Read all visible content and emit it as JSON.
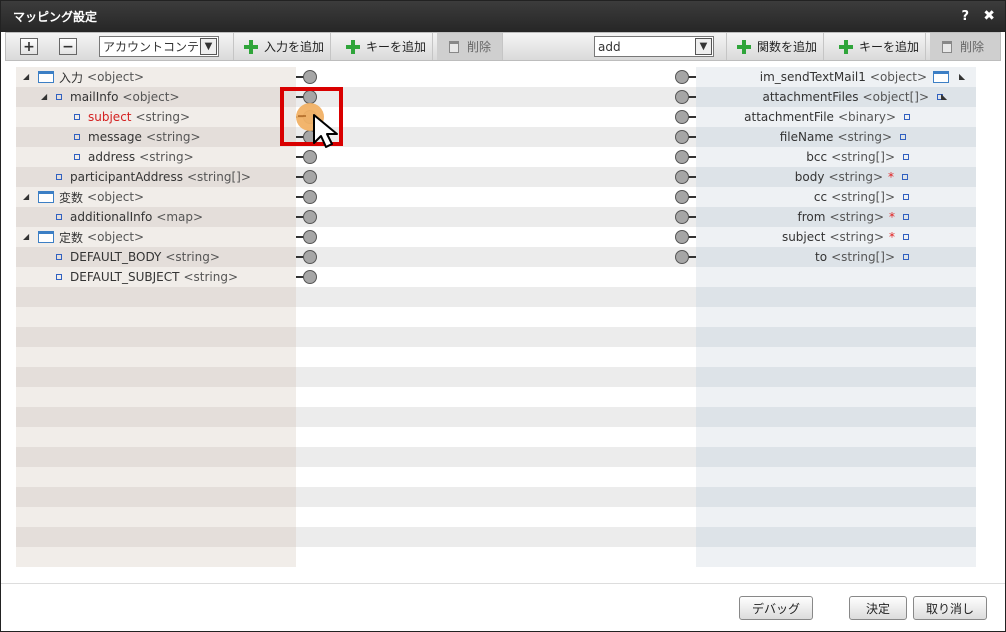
{
  "dialog": {
    "title": "マッピング設定",
    "help_label": "?",
    "close_label": "✖"
  },
  "toolbar": {
    "expand_label": "+",
    "collapse_label": "−",
    "input_select_value": "アカウントコンテ",
    "add_input_label": "入力を追加",
    "add_key_left_label": "キーを追加",
    "delete_left_label": "削除",
    "function_select_value": "add",
    "add_function_label": "関数を追加",
    "add_key_right_label": "キーを追加",
    "delete_right_label": "削除"
  },
  "left_tree": [
    {
      "name": "入力",
      "type": "<object>",
      "icon": "folder-icon",
      "expander": "◢"
    },
    {
      "name": "mailInfo",
      "type": "<object>",
      "icon": "leaf-icon",
      "expander": "◢"
    },
    {
      "name": "subject",
      "type": "<string>",
      "icon": "leaf-icon",
      "highlight": true
    },
    {
      "name": "message",
      "type": "<string>",
      "icon": "leaf-icon"
    },
    {
      "name": "address",
      "type": "<string>",
      "icon": "leaf-icon"
    },
    {
      "name": "participantAddress",
      "type": "<string[]>",
      "icon": "leaf-icon"
    },
    {
      "name": "変数",
      "type": "<object>",
      "icon": "folder-icon",
      "expander": "◢"
    },
    {
      "name": "additionalInfo",
      "type": "<map>",
      "icon": "leaf-icon"
    },
    {
      "name": "定数",
      "type": "<object>",
      "icon": "folder-icon",
      "expander": "◢"
    },
    {
      "name": "DEFAULT_BODY",
      "type": "<string>",
      "icon": "leaf-icon"
    },
    {
      "name": "DEFAULT_SUBJECT",
      "type": "<string>",
      "icon": "leaf-icon"
    }
  ],
  "right_tree": [
    {
      "name": "im_sendTextMail1",
      "type": "<object>",
      "icon": "folder-icon",
      "expander": "◣"
    },
    {
      "name": "attachmentFiles",
      "type": "<object[]>",
      "icon": "leaf-icon",
      "expander": "◣"
    },
    {
      "name": "attachmentFile",
      "type": "<binary>",
      "icon": "leaf-icon"
    },
    {
      "name": "fileName",
      "type": "<string>",
      "icon": "leaf-icon"
    },
    {
      "name": "bcc",
      "type": "<string[]>",
      "icon": "leaf-icon"
    },
    {
      "name": "body",
      "type": "<string>",
      "icon": "leaf-icon",
      "required": "*"
    },
    {
      "name": "cc",
      "type": "<string[]>",
      "icon": "leaf-icon"
    },
    {
      "name": "from",
      "type": "<string>",
      "icon": "leaf-icon",
      "required": "*"
    },
    {
      "name": "subject",
      "type": "<string>",
      "icon": "leaf-icon",
      "required": "*"
    },
    {
      "name": "to",
      "type": "<string[]>",
      "icon": "leaf-icon"
    }
  ],
  "footer": {
    "debug_label": "デバッグ",
    "ok_label": "決定",
    "cancel_label": "取り消し"
  },
  "colors": {
    "highlight_border": "#d90000",
    "hover_dot": "#f2b266",
    "required_mark": "#e02020"
  }
}
